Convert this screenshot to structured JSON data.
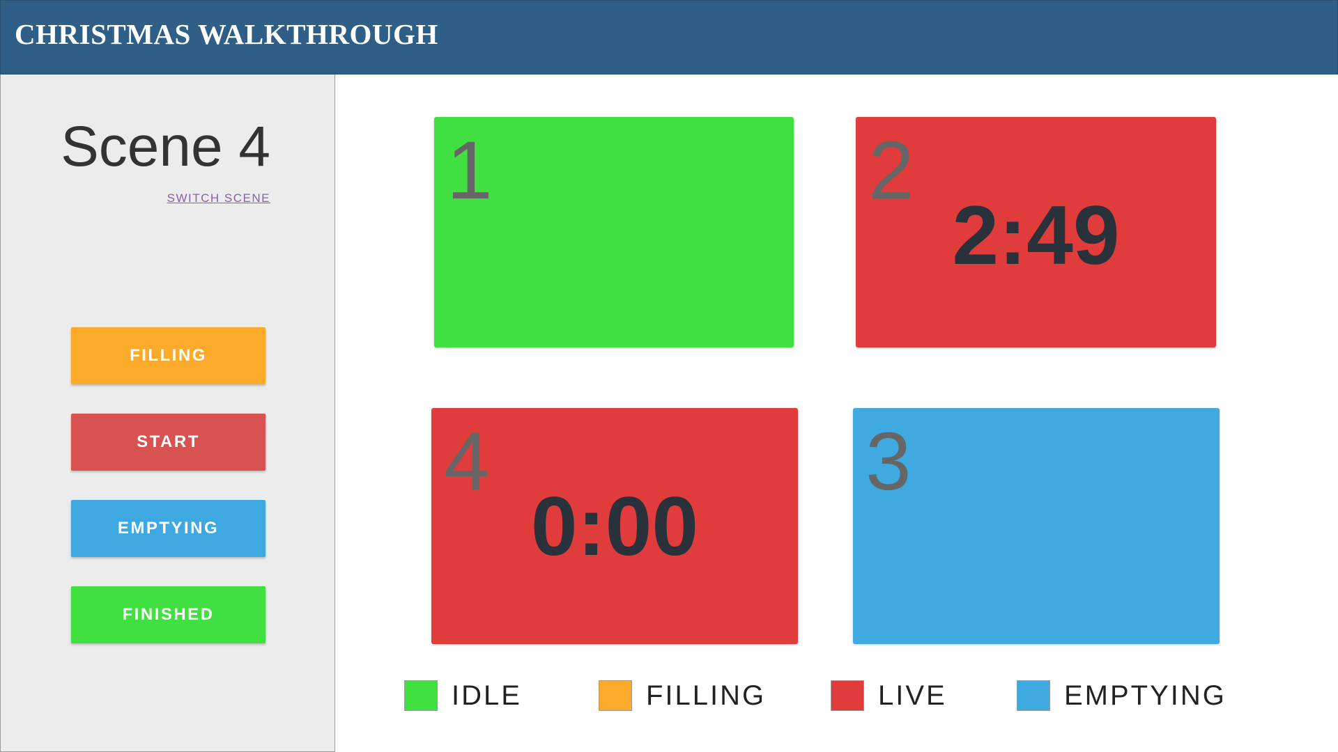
{
  "header": {
    "title": "CHRISTMAS WALKTHROUGH"
  },
  "sidebar": {
    "scene_title": "Scene 4",
    "switch_scene_label": "SWITCH SCENE",
    "buttons": [
      {
        "label": "FILLING",
        "color": "#fbab29"
      },
      {
        "label": "START",
        "color": "#d95252"
      },
      {
        "label": "EMPTYING",
        "color": "#3ea8e0"
      },
      {
        "label": "FINISHED",
        "color": "#40e040"
      }
    ]
  },
  "rooms": [
    {
      "number": "1",
      "timer": "",
      "state": "idle",
      "color": "#40e040"
    },
    {
      "number": "2",
      "timer": "2:49",
      "state": "live",
      "color": "#e03c3c"
    },
    {
      "number": "4",
      "timer": "0:00",
      "state": "live",
      "color": "#e03c3c"
    },
    {
      "number": "3",
      "timer": "",
      "state": "emptying",
      "color": "#3eaae0"
    }
  ],
  "legend": [
    {
      "label": "IDLE",
      "color": "#40e040"
    },
    {
      "label": "FILLING",
      "color": "#fbab29"
    },
    {
      "label": "LIVE",
      "color": "#e03c3c"
    },
    {
      "label": "EMPTYING",
      "color": "#3eaae0"
    }
  ]
}
